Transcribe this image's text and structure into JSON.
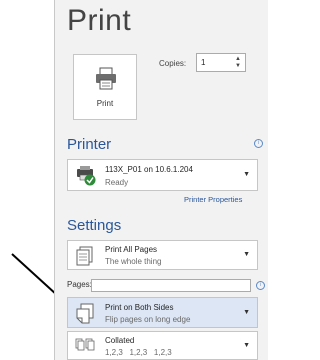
{
  "title": "Print",
  "print_button": {
    "label": "Print"
  },
  "copies": {
    "label": "Copies:",
    "value": "1"
  },
  "printer": {
    "heading": "Printer",
    "name": "113X_P01 on 10.6.1.204",
    "status": "Ready",
    "properties_link": "Printer Properties"
  },
  "settings": {
    "heading": "Settings",
    "pages_range": {
      "main": "Print All Pages",
      "sub": "The whole thing"
    },
    "pages_label": "Pages:",
    "pages_value": "",
    "sides": {
      "main": "Print on Both Sides",
      "sub": "Flip pages on long edge"
    },
    "collation": {
      "main": "Collated",
      "sub": "1,2,3   1,2,3   1,2,3"
    }
  },
  "icons": {
    "printer_icon": "printer-icon",
    "info_icon": "info-icon",
    "arrow": "arrow-pointer"
  },
  "colors": {
    "accent": "#2b579a",
    "selected": "#dce6f4",
    "panel": "#f2f2f2"
  }
}
